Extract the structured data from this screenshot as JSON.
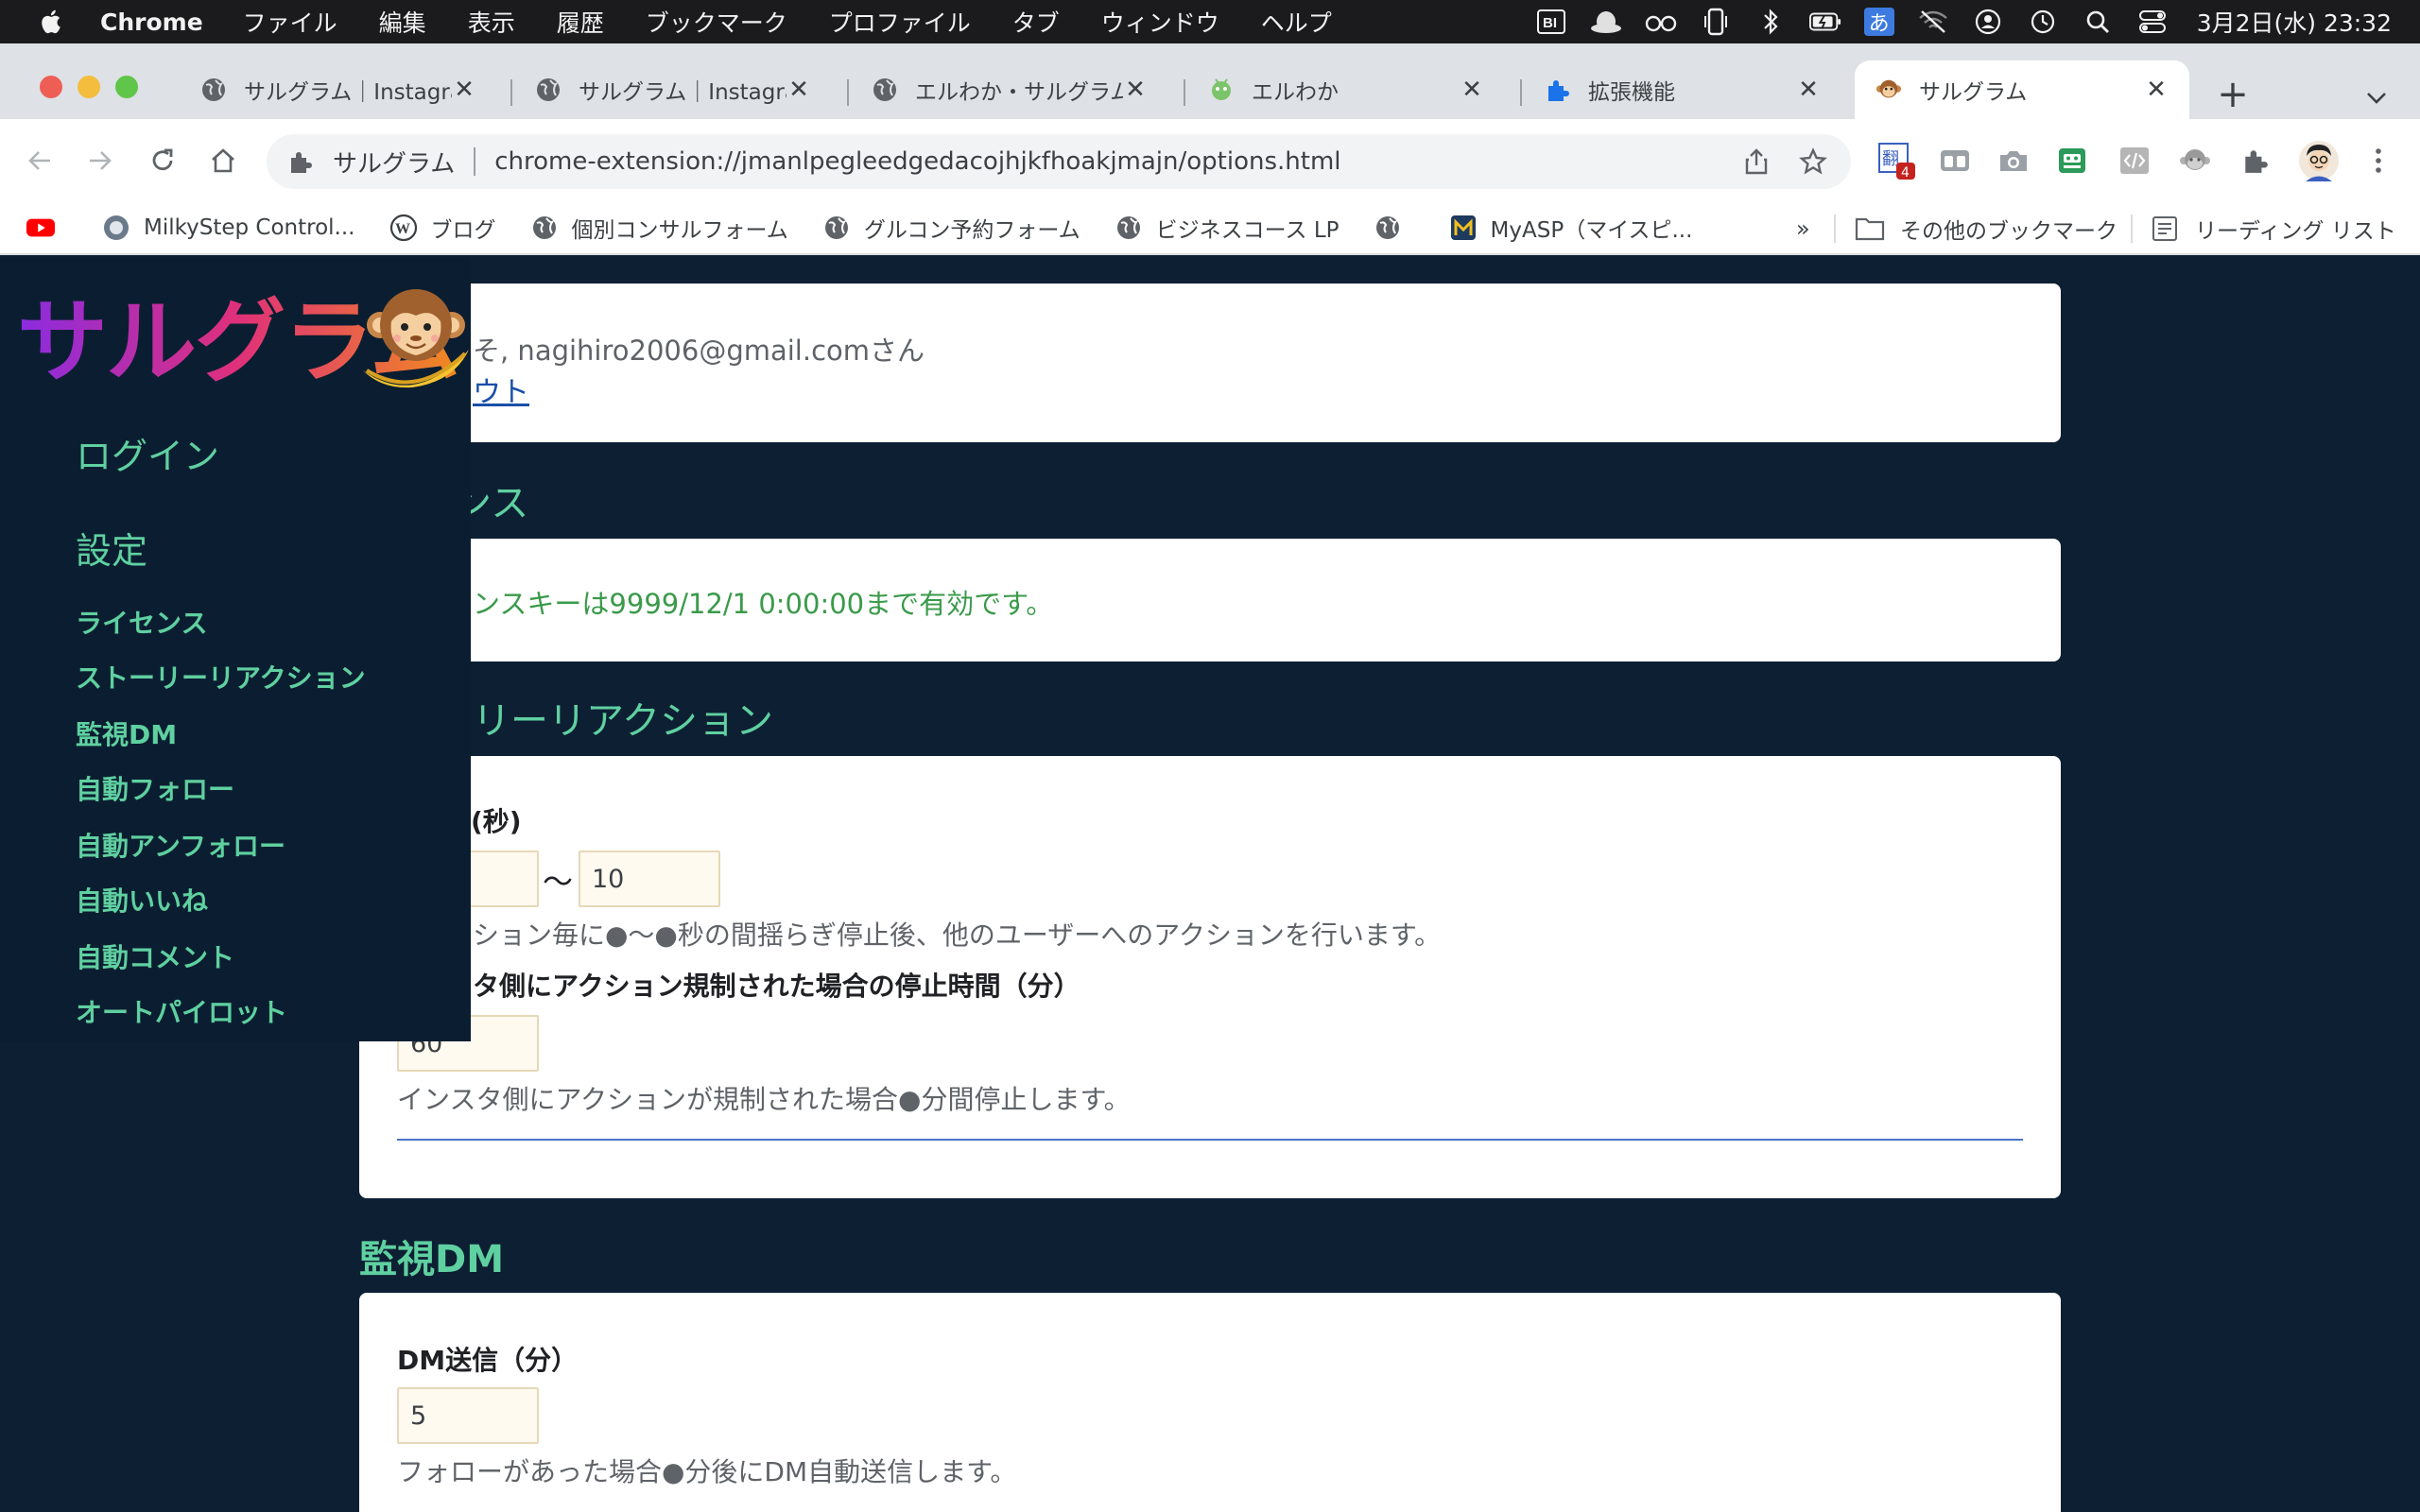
{
  "menubar": {
    "app": "Chrome",
    "items": [
      "ファイル",
      "編集",
      "表示",
      "履歴",
      "ブックマーク",
      "プロファイル",
      "タブ",
      "ウィンドウ",
      "ヘルプ"
    ],
    "clock": "3月2日(水)  23:32",
    "ime": "あ"
  },
  "tabs": [
    {
      "label": "サルグラム｜Instagram"
    },
    {
      "label": "サルグラム｜Instagram"
    },
    {
      "label": "エルわか・サルグラム"
    },
    {
      "label": "エルわか"
    },
    {
      "label": "拡張機能"
    },
    {
      "label": "サルグラム"
    }
  ],
  "omnibox": {
    "origin": "サルグラム",
    "url": "chrome-extension://jmanlpegleedgedacojhjkfhoakjmajn/options.html"
  },
  "extension_badge": "4",
  "bookmarks": {
    "items": [
      "MilkyStep Control...",
      "ブログ",
      "個別コンサルフォーム",
      "グルコン予約フォーム",
      "ビジネスコース LP",
      "MyASP（マイスピ..."
    ],
    "overflow": "»",
    "other": "その他のブックマーク",
    "reading": "リーディング リスト"
  },
  "sidebar": {
    "logo": "サルグラム",
    "login": "ログイン",
    "settings": "設定",
    "items": [
      "ライセンス",
      "ストーリーリアクション",
      "監視DM",
      "自動フォロー",
      "自動アンフォロー",
      "自動いいね",
      "自動コメント",
      "オートパイロット"
    ]
  },
  "account": {
    "welcome": "そ, nagihiro2006@gmail.comさん",
    "logout": "ウト"
  },
  "license": {
    "title": "ンス",
    "message": "ンスキーは9999/12/1 0:00:00まで有効です。"
  },
  "story": {
    "title": "リーリアクション",
    "interval_label": "(秒)",
    "interval_tilde": "〜",
    "interval_max": "10",
    "interval_help": "ション毎に●〜●秒の間揺らぎ停止後、他のユーザーへのアクションを行います。",
    "stop_label": "タ側にアクション規制された場合の停止時間（分）",
    "stop_value": "60",
    "stop_help": "インスタ側にアクションが規制された場合●分間停止します。"
  },
  "dm": {
    "title": "監視DM",
    "label": "DM送信（分）",
    "value": "5",
    "help": "フォローがあった場合●分後にDM自動送信します。"
  },
  "colors": {
    "page_bg": "#0d1f33",
    "accent_green": "#5fd0a0",
    "license_green": "#3a9a4a",
    "divider_blue": "#4a74c8"
  }
}
